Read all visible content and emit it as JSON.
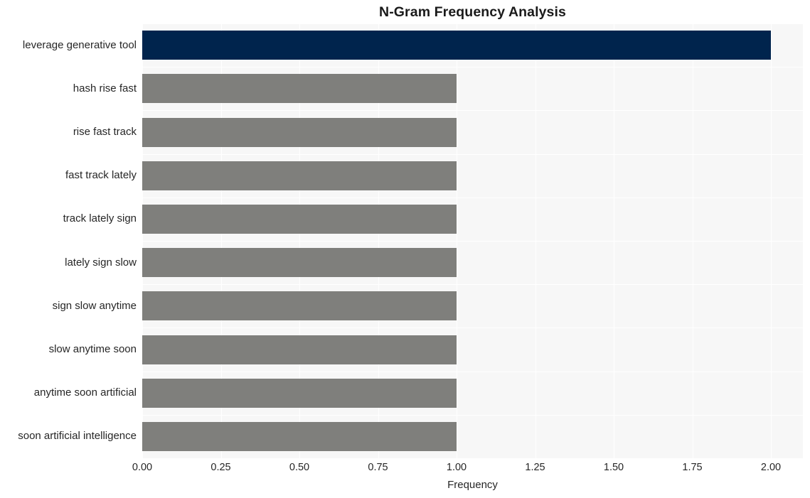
{
  "chart_data": {
    "type": "bar",
    "orientation": "horizontal",
    "title": "N-Gram Frequency Analysis",
    "xlabel": "Frequency",
    "ylabel": "",
    "categories": [
      "leverage generative tool",
      "hash rise fast",
      "rise fast track",
      "fast track lately",
      "track lately sign",
      "lately sign slow",
      "sign slow anytime",
      "slow anytime soon",
      "anytime soon artificial",
      "soon artificial intelligence"
    ],
    "values": [
      2,
      1,
      1,
      1,
      1,
      1,
      1,
      1,
      1,
      1
    ],
    "xlim": [
      0,
      2.0
    ],
    "xticks": [
      0.0,
      0.25,
      0.5,
      0.75,
      1.0,
      1.25,
      1.5,
      1.75,
      2.0
    ],
    "xtick_labels": [
      "0.00",
      "0.25",
      "0.50",
      "0.75",
      "1.00",
      "1.25",
      "1.50",
      "1.75",
      "2.00"
    ],
    "grid": true,
    "legend": false,
    "bar_colors": [
      "#00244d",
      "#7f7f7c",
      "#7f7f7c",
      "#7f7f7c",
      "#7f7f7c",
      "#7f7f7c",
      "#7f7f7c",
      "#7f7f7c",
      "#7f7f7c",
      "#7f7f7c"
    ],
    "highlight_color": "#00244d",
    "default_color": "#7f7f7c",
    "plot_background": "#f7f7f7",
    "gridline_color": "#ffffff",
    "figure_background": "#ffffff"
  }
}
